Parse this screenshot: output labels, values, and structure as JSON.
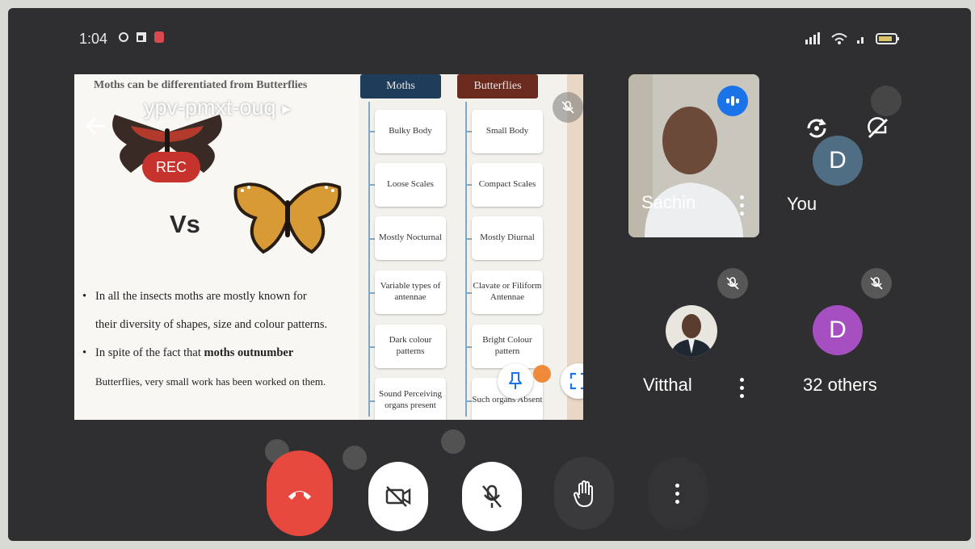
{
  "status_bar": {
    "time": "1:04"
  },
  "meeting": {
    "code": "ypv-pmxt-ouq",
    "rec_label": "REC"
  },
  "slide": {
    "title": "Moths can be differentiated from Butterflies",
    "vs_label": "Vs",
    "bullets": [
      {
        "lines": [
          "In all the insects moths are mostly known for",
          "their diversity of shapes, size and colour patterns."
        ]
      },
      {
        "line1_prefix": "In spite of the fact that ",
        "line1_bold": "moths outnumber",
        "line2": "Butterflies, very small work has been worked on them."
      }
    ],
    "table": {
      "moths_header": "Moths",
      "butterflies_header": "Butterflies",
      "moths": [
        "Bulky Body",
        "Loose Scales",
        "Mostly Nocturnal",
        "Variable types of antennae",
        "Dark colour patterns",
        "Sound Perceiving organs present"
      ],
      "butterflies": [
        "Small Body",
        "Compact Scales",
        "Mostly Diurnal",
        "Clavate or Filiform Antennae",
        "Bright Colour pattern",
        "Such organs Absent"
      ]
    }
  },
  "participants": {
    "sachin": {
      "name": "Sachin"
    },
    "you": {
      "name": "You",
      "initial": "D"
    },
    "vitthal": {
      "name": "Vitthal"
    },
    "others": {
      "label": "32 others",
      "initial": "D"
    }
  },
  "colors": {
    "end_call": "#e8493f",
    "others_avatar": "#a54fc0",
    "you_avatar": "#4f6e83",
    "accent_blue": "#1a73e8",
    "speaking_badge": "#1a73e8"
  }
}
